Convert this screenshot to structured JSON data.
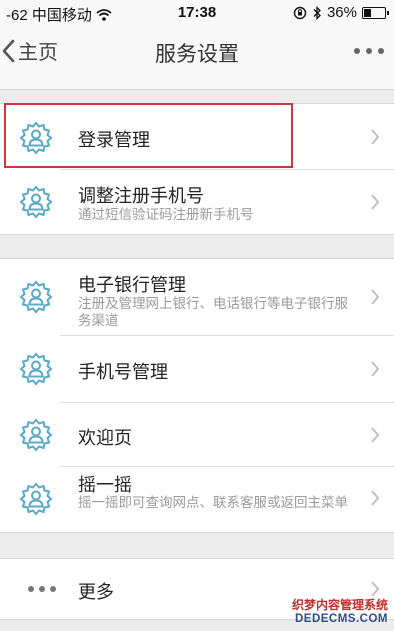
{
  "status_bar": {
    "carrier": "-62 中国移动",
    "time": "17:38",
    "battery": "36%",
    "battery_level": 0.36
  },
  "nav": {
    "back_label": "主页",
    "title": "服务设置"
  },
  "items": [
    {
      "title": "登录管理",
      "subtitle": ""
    },
    {
      "title": "调整注册手机号",
      "subtitle": "通过短信验证码注册新手机号"
    },
    {
      "title": "电子银行管理",
      "subtitle": "注册及管理网上银行、电话银行等电子银行服务渠道"
    },
    {
      "title": "手机号管理",
      "subtitle": ""
    },
    {
      "title": "欢迎页",
      "subtitle": ""
    },
    {
      "title": "摇一摇",
      "subtitle": "摇一摇即可查询网点、联系客服或返回主菜单"
    }
  ],
  "more": {
    "title": "更多"
  },
  "watermark": {
    "line1": "织梦内容管理系统",
    "line2": "DEDECMS.COM"
  },
  "colors": {
    "icon": "#5aa9c8",
    "highlight": "#d0343c"
  },
  "icons": {
    "item": "gear-user-icon",
    "chevron": "chevron-right-icon",
    "back": "chevron-left-icon"
  }
}
